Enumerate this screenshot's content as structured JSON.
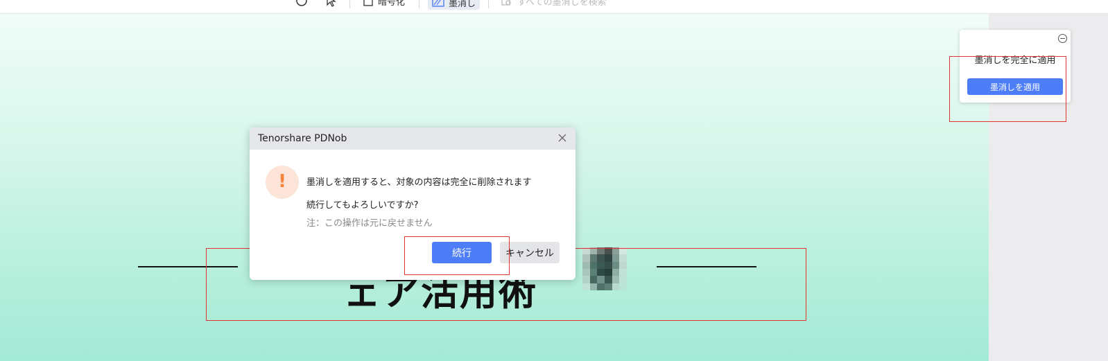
{
  "toolbar": {
    "password_label": "暗号化",
    "redact_label": "墨消し",
    "search_all_label": "すべての墨消しを検索"
  },
  "document": {
    "heading_visible": "ェア活用術"
  },
  "apply_card": {
    "title": "墨消しを完全に適用",
    "button_label": "墨消しを適用"
  },
  "dialog": {
    "title": "Tenorshare PDNob",
    "message": "墨消しを適用すると、対象の内容は完全に削除されます",
    "question": "続行してもよろしいですか?",
    "note": "注：この操作は元に戻せません",
    "confirm_label": "続行",
    "cancel_label": "キャンセル",
    "warning_symbol": "!"
  },
  "colors": {
    "accent": "#4d7df7",
    "highlight": "#e0342d",
    "warning": "#f7843a"
  }
}
